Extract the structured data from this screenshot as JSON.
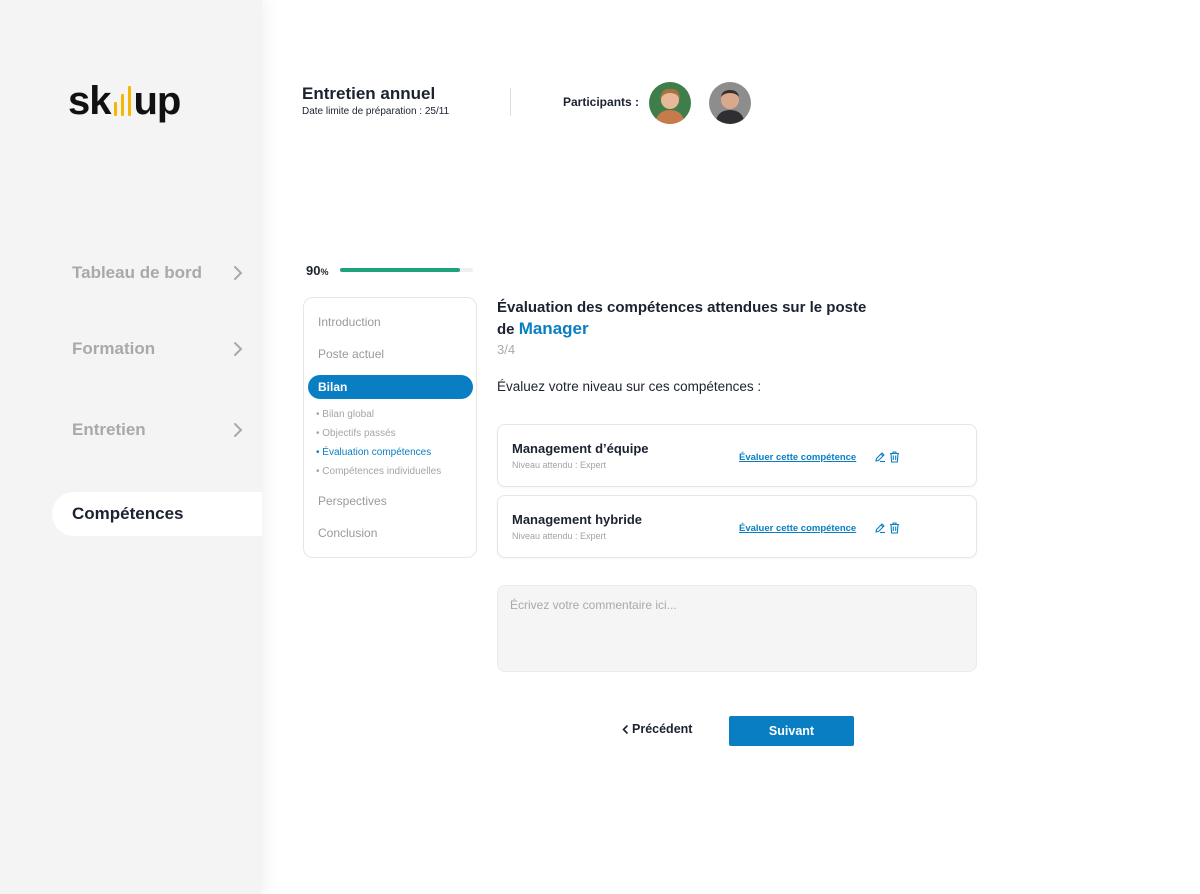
{
  "brand": {
    "logo_prefix": "sk",
    "logo_suffix": "up",
    "accent": "#f5b800"
  },
  "sidebar": {
    "items": [
      {
        "label": "Tableau de bord",
        "icon": "chevron-right-icon"
      },
      {
        "label": "Formation",
        "icon": "chevron-right-icon"
      },
      {
        "label": "Entretien",
        "icon": "chevron-right-icon"
      },
      {
        "label": "Compétences",
        "active": true
      }
    ]
  },
  "header": {
    "title": "Entretien annuel",
    "subtitle": "Date limite de préparation : 25/11",
    "participants_label": "Participants :",
    "participants": [
      {
        "name": "avatar-woman"
      },
      {
        "name": "avatar-man"
      }
    ]
  },
  "progress": {
    "value": "90",
    "unit": "%",
    "fraction": 0.9,
    "color": "#1ea37d"
  },
  "steps": {
    "items": [
      "Introduction",
      "Poste actuel",
      "Bilan",
      "Perspectives",
      "Conclusion"
    ],
    "active": "Bilan",
    "substeps": [
      "• Bilan global",
      "• Objectifs passés",
      "• Évaluation compétences",
      "• Compétences individuelles"
    ],
    "current_substep": "• Évaluation compétences"
  },
  "main": {
    "title_line1": "Évaluation des compétences attendues sur le poste",
    "title_prefix": "de ",
    "title_accent": "Manager",
    "step_counter": "3/4",
    "prompt": "Évaluez votre niveau sur ces compétences :",
    "competences": [
      {
        "name": "Management d’équipe",
        "level": "Niveau attendu : Expert",
        "action": "Évaluer cette compétence"
      },
      {
        "name": "Management hybride",
        "level": "Niveau attendu : Expert",
        "action": "Évaluer cette compétence"
      }
    ],
    "comment_placeholder": "Écrivez votre commentaire ici..."
  },
  "footer": {
    "prev_label": "Précédent",
    "prev_icon": "chevron-left-icon",
    "next_label": "Suivant"
  },
  "colors": {
    "primary": "#0a7ec2",
    "text": "#1c2230",
    "muted": "#a9a9a9"
  }
}
